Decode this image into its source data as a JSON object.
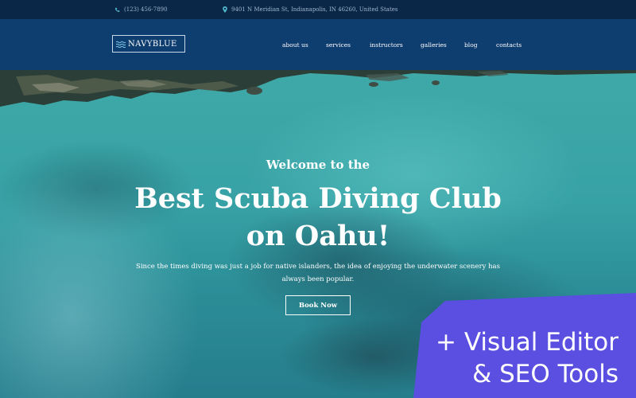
{
  "topbar": {
    "phone": "(123) 456-7890",
    "address": "9401 N Meridian St, Indianapolis, IN 46260, United States"
  },
  "logo": {
    "text": "NAVYBLUE"
  },
  "nav": {
    "items": [
      "about us",
      "services",
      "instructors",
      "galleries",
      "blog",
      "contacts"
    ]
  },
  "hero": {
    "pre_title": "Welcome to the",
    "title_line1": "Best Scuba Diving Club",
    "title_line2": "on Oahu!",
    "description": "Since the times diving was just a job for native islanders, the idea of enjoying the underwater scenery has always been popular.",
    "button_label": "Book Now"
  },
  "promo": {
    "line1": "+ Visual Editor",
    "line2": "& SEO Tools"
  },
  "colors": {
    "topbar_bg": "#0b2748",
    "nav_bg": "#0e3d70",
    "water": "#3fa9a8",
    "promo": "#5a4fe0"
  }
}
